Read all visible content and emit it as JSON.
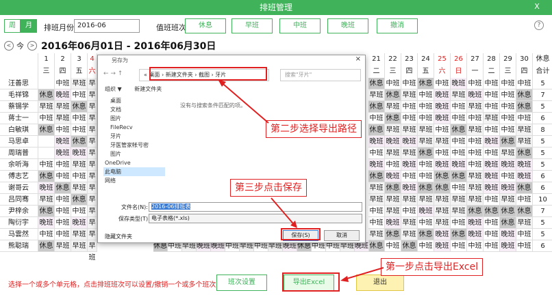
{
  "window": {
    "title": "排班管理",
    "close": "X"
  },
  "toolbar": {
    "week": "周",
    "month": "月",
    "month_label": "排班月份",
    "month_value": "2016-06",
    "shift_label": "值班班次",
    "shifts": [
      "休息",
      "早班",
      "中班",
      "晚班",
      "撤消"
    ],
    "help": "?"
  },
  "date_range": "2016年06月01日 - 2016年06月30日",
  "nav": {
    "prev": "<",
    "today": "今",
    "next": ">"
  },
  "columns": [
    {
      "d": "",
      "w": ""
    },
    {
      "d": "1",
      "w": "三"
    },
    {
      "d": "2",
      "w": "四"
    },
    {
      "d": "3",
      "w": "五"
    },
    {
      "d": "4",
      "w": "六"
    }
  ],
  "right_columns": [
    {
      "d": "21",
      "w": "二"
    },
    {
      "d": "22",
      "w": "三"
    },
    {
      "d": "23",
      "w": "四"
    },
    {
      "d": "24",
      "w": "五"
    },
    {
      "d": "25",
      "w": "六"
    },
    {
      "d": "26",
      "w": "日"
    },
    {
      "d": "27",
      "w": "一"
    },
    {
      "d": "28",
      "w": "二"
    },
    {
      "d": "29",
      "w": "三"
    },
    {
      "d": "30",
      "w": "四"
    },
    {
      "d": "休息",
      "w": "合计"
    }
  ],
  "rows": [
    {
      "name": "汪善思",
      "left": [
        "",
        "中班",
        "早班",
        "早班"
      ],
      "right": [
        "休息",
        "中班",
        "中班",
        "休息",
        "中班",
        "晚班",
        "中班",
        "中班",
        "中班",
        "中班"
      ],
      "total": "5"
    },
    {
      "name": "毛祥锦",
      "left": [
        "休息",
        "晚班",
        "中班",
        "早班"
      ],
      "right": [
        "早班",
        "休息",
        "早班",
        "中班",
        "晚班",
        "早班",
        "晚班",
        "中班",
        "中班",
        "休息"
      ],
      "total": "7"
    },
    {
      "name": "蔡锡学",
      "left": [
        "早班",
        "早班",
        "休息",
        "早班"
      ],
      "right": [
        "休息",
        "早班",
        "中班",
        "中班",
        "晚班",
        "中班",
        "早班",
        "中班",
        "中班",
        "休息"
      ],
      "total": "5"
    },
    {
      "name": "蒋士一",
      "left": [
        "中班",
        "早班",
        "中班",
        "早班"
      ],
      "right": [
        "中班",
        "休息",
        "中班",
        "中班",
        "晚班",
        "中班",
        "中班",
        "早班",
        "中班",
        "中班"
      ],
      "total": "6"
    },
    {
      "name": "白敏琪",
      "left": [
        "休息",
        "中班",
        "中班",
        "早班"
      ],
      "right": [
        "休息",
        "早班",
        "早班",
        "早班",
        "中班",
        "休息",
        "早班",
        "中班",
        "中班",
        "早班"
      ],
      "total": "8"
    },
    {
      "name": "马思卓",
      "left": [
        "",
        "晚班",
        "休息",
        "早班"
      ],
      "right": [
        "晚班",
        "晚班",
        "晚班",
        "早班",
        "早班",
        "中班",
        "中班",
        "晚班",
        "休息",
        "早班"
      ],
      "total": "5"
    },
    {
      "name": "周瑞普",
      "left": [
        "",
        "晚班",
        "晚班",
        "早班"
      ],
      "right": [
        "中班",
        "早班",
        "早班",
        "休息",
        "中班",
        "中班",
        "中班",
        "中班",
        "早班",
        "休息"
      ],
      "total": "5"
    },
    {
      "name": "余听海",
      "left": [
        "中班",
        "中班",
        "早班",
        "早班"
      ],
      "right": [
        "晚班",
        "中班",
        "晚班",
        "中班",
        "晚班",
        "晚班",
        "中班",
        "晚班",
        "晚班",
        "晚班"
      ],
      "total": "5"
    },
    {
      "name": "傅志艺",
      "left": [
        "休息",
        "中班",
        "中班",
        "早班"
      ],
      "right": [
        "休息",
        "晚班",
        "中班",
        "中班",
        "休息",
        "休息",
        "早班",
        "晚班",
        "中班",
        "晚班"
      ],
      "total": "6"
    },
    {
      "name": "谢哥云",
      "left": [
        "晚班",
        "休息",
        "早班",
        "早班"
      ],
      "right": [
        "早班",
        "休息",
        "晚班",
        "休息",
        "休息",
        "中班",
        "早班",
        "晚班",
        "晚班",
        "休息"
      ],
      "total": "6"
    },
    {
      "name": "吕同骞",
      "left": [
        "早班",
        "中班",
        "休息",
        "早班"
      ],
      "right": [
        "早班",
        "早班",
        "早班",
        "早班",
        "早班",
        "早班",
        "早班",
        "中班",
        "早班",
        "中班"
      ],
      "total": "10"
    },
    {
      "name": "尹梓余",
      "left": [
        "休息",
        "中班",
        "中班",
        "早班"
      ],
      "right": [
        "中班",
        "早班",
        "中班",
        "晚班",
        "早班",
        "早班",
        "休息",
        "休息",
        "休息",
        "休息"
      ],
      "total": "7"
    },
    {
      "name": "陶衍宇",
      "left": [
        "晚班",
        "中班",
        "晚班",
        "早班"
      ],
      "right": [
        "中班",
        "晚班",
        "早班",
        "中班",
        "早班",
        "中班",
        "晚班",
        "中班",
        "休息",
        "早班"
      ],
      "total": "5"
    },
    {
      "name": "马雲然",
      "left": [
        "中班",
        "中班",
        "早班",
        "早班"
      ],
      "right": [
        "早班",
        "休息",
        "早班",
        "休息",
        "晚班",
        "休息",
        "晚班",
        "中班",
        "晚班",
        "中班"
      ],
      "total": "5"
    },
    {
      "name": "熊聪瑞",
      "left": [
        "休息",
        "早班",
        "早班",
        "早班"
      ],
      "right": [
        "休息",
        "中班",
        "休息",
        "中班",
        "晚班",
        "中班",
        "中班",
        "中班",
        "晚班",
        "中班"
      ],
      "total": "6"
    }
  ],
  "bottom_row": [
    "休息",
    "中班",
    "早班",
    "晚班",
    "晚班",
    "中班",
    "早班",
    "中班",
    "早班",
    "晚班",
    "休息",
    "中班",
    "中班",
    "早班",
    "晚班"
  ],
  "footer": {
    "hint": "选择一个或多个单元格，点击排班班次可以设置/撤销一个或多个班次",
    "set_btn": "班次设置",
    "export_btn": "导出Excel",
    "exit_btn": "退出"
  },
  "dialog": {
    "title": "另存为",
    "close": "×",
    "address": "« 桌面 › 新建文件夹 › 截图 › 牙片",
    "search": "搜索\"牙片\"",
    "organize": "组织 ▼",
    "new_folder": "新建文件夹",
    "empty_msg": "没有与搜索条件匹配的项。",
    "tree": [
      "桌面",
      "文档",
      "图片",
      "FileRecv",
      "牙片",
      "牙医管家帐号密",
      "图片",
      "OneDrive",
      "此电脑",
      "网络"
    ],
    "filename_label": "文件名(N):",
    "filename_value": "2016-06排班表",
    "type_label": "保存类型(T):",
    "type_value": "电子表格(*.xls)",
    "hide_folders": "隐藏文件夹",
    "save": "保存(S)",
    "cancel": "取消"
  },
  "annotations": {
    "step1": "第一步点击导出Excel",
    "step2": "第二步选择导出路径",
    "step3": "第三步点击保存"
  },
  "colors": {
    "green": "#3fb25a",
    "red": "#e02020"
  }
}
